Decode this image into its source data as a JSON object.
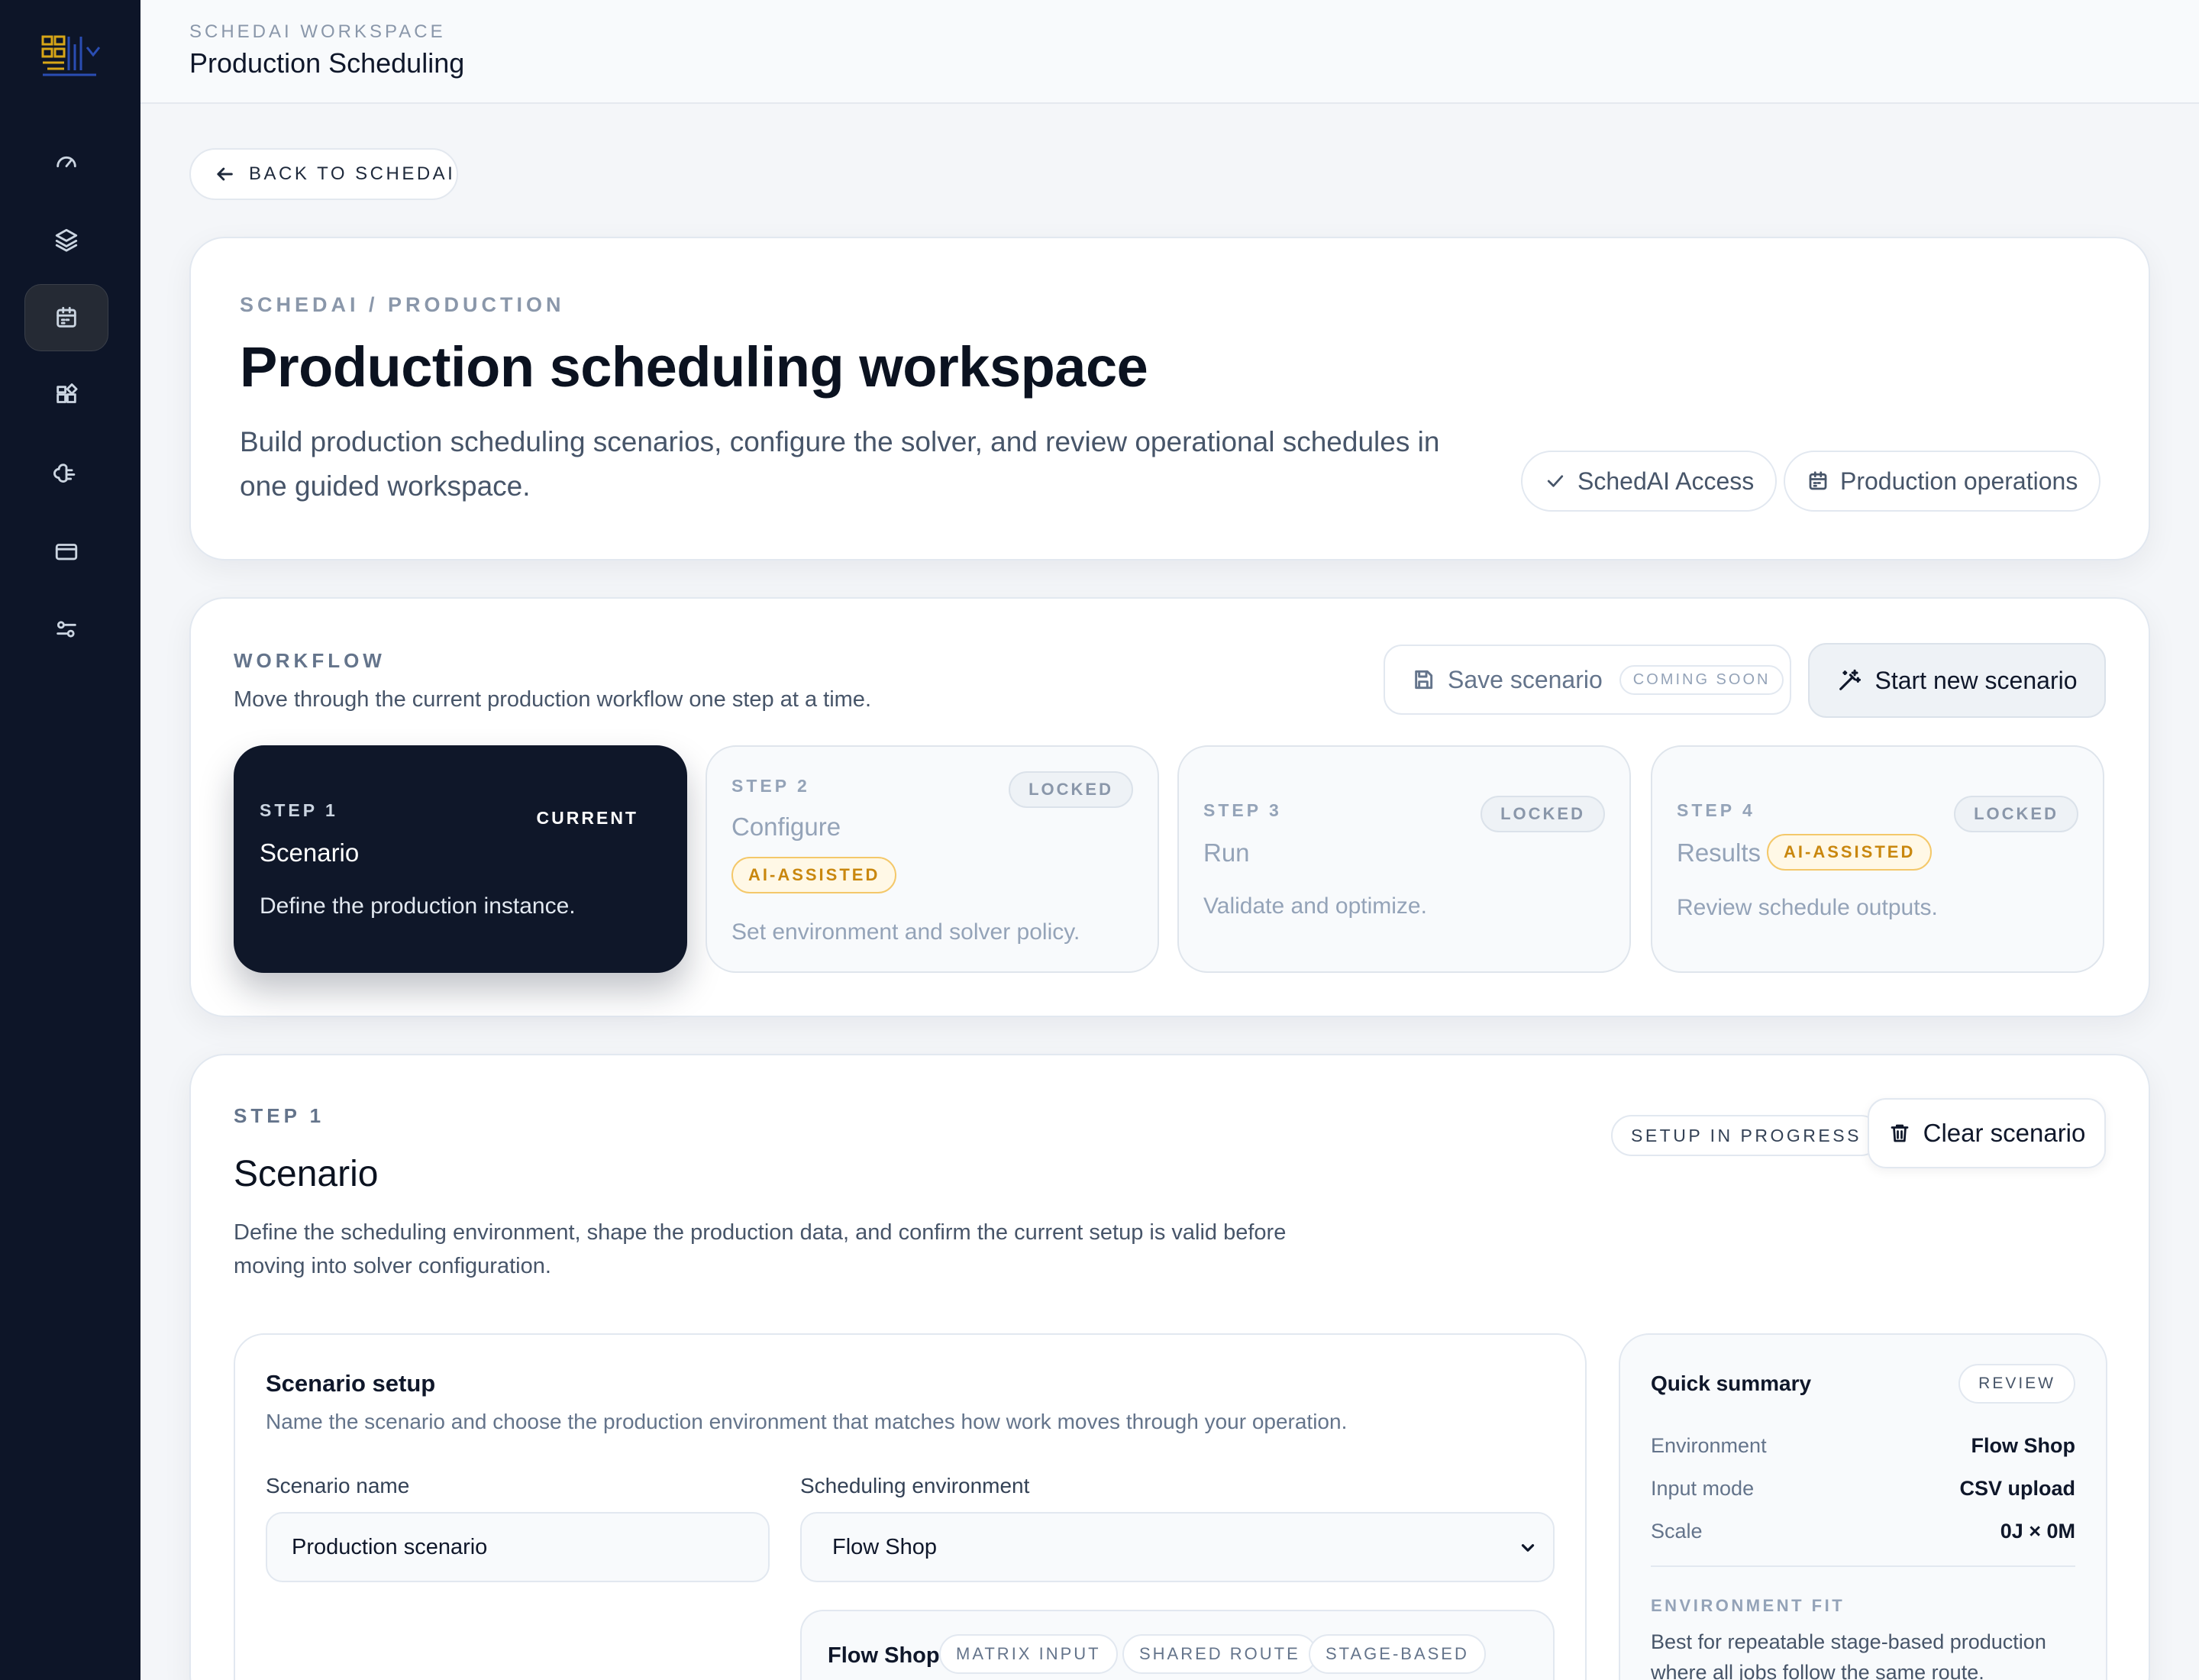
{
  "header": {
    "eyebrow": "SCHEDAI WORKSPACE",
    "title": "Production Scheduling"
  },
  "back_button": {
    "label": "BACK TO SCHEDAI"
  },
  "hero": {
    "crumb": "SCHEDAI / PRODUCTION",
    "title": "Production scheduling workspace",
    "description": "Build production scheduling scenarios, configure the solver, and review operational schedules in one guided workspace.",
    "pills": [
      "SchedAI Access",
      "Production operations"
    ]
  },
  "sidebar": {
    "items": [
      "dashboard-icon",
      "layers-icon",
      "calendar-icon",
      "apps-icon",
      "brain-icon",
      "card-icon",
      "settings-icon"
    ],
    "active_index": 2
  },
  "workflow": {
    "eyebrow": "WORKFLOW",
    "description": "Move through the current production workflow one step at a time.",
    "save_label": "Save scenario",
    "save_badge": "COMING SOON",
    "start_label": "Start new scenario",
    "steps": [
      {
        "label": "STEP 1",
        "name": "Scenario",
        "desc": "Define the production instance.",
        "status": "CURRENT"
      },
      {
        "label": "STEP 2",
        "name": "Configure",
        "desc": "Set environment and solver policy.",
        "status": "LOCKED",
        "badge": "AI-ASSISTED"
      },
      {
        "label": "STEP 3",
        "name": "Run",
        "desc": "Validate and optimize.",
        "status": "LOCKED"
      },
      {
        "label": "STEP 4",
        "name": "Results",
        "desc": "Review schedule outputs.",
        "status": "LOCKED",
        "badge": "AI-ASSISTED"
      }
    ]
  },
  "scenario": {
    "eyebrow": "STEP 1",
    "title": "Scenario",
    "description": "Define the scheduling environment, shape the production data, and confirm the current setup is valid before moving into solver configuration.",
    "status": "SETUP IN PROGRESS",
    "clear_label": "Clear scenario",
    "setup": {
      "title": "Scenario setup",
      "hint": "Name the scenario and choose the production environment that matches how work moves through your operation.",
      "name_label": "Scenario name",
      "name_value": "Production scenario",
      "env_label": "Scheduling environment",
      "env_value": "Flow Shop",
      "env_card": {
        "name": "Flow Shop",
        "tags": [
          "MATRIX INPUT",
          "SHARED ROUTE",
          "STAGE-BASED"
        ]
      }
    },
    "summary": {
      "title": "Quick summary",
      "badge": "REVIEW",
      "rows": [
        {
          "k": "Environment",
          "v": "Flow Shop"
        },
        {
          "k": "Input mode",
          "v": "CSV upload"
        },
        {
          "k": "Scale",
          "v": "0J × 0M"
        }
      ],
      "fit_label": "ENVIRONMENT FIT",
      "fit_text": "Best for repeatable stage-based production where all jobs follow the same route."
    }
  }
}
